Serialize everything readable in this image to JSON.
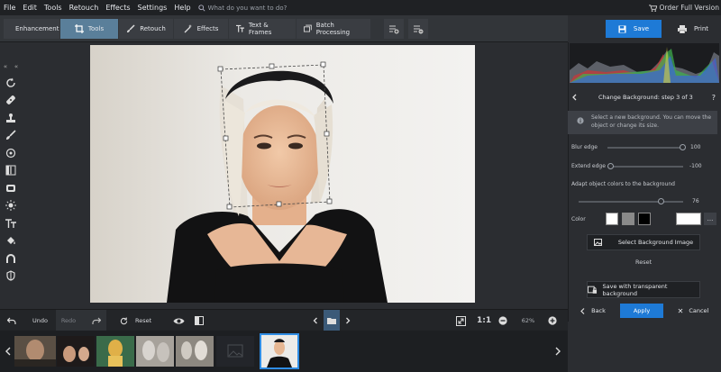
{
  "menu": {
    "items": [
      "File",
      "Edit",
      "Tools",
      "Retouch",
      "Effects",
      "Settings",
      "Help"
    ],
    "search_placeholder": "What do you want to do?",
    "order_label": "Order Full Version"
  },
  "toolbar": {
    "tabs": [
      {
        "label": "Enhancement",
        "icon": "sliders-icon",
        "active": false
      },
      {
        "label": "Tools",
        "icon": "crop-icon",
        "active": true
      },
      {
        "label": "Retouch",
        "icon": "brush-icon",
        "active": false
      },
      {
        "label": "Effects",
        "icon": "magic-wand-icon",
        "active": false
      },
      {
        "label": "Text & Frames",
        "icon": "text-icon",
        "active": false
      },
      {
        "label": "Batch Processing",
        "icon": "batch-icon",
        "active": false
      }
    ],
    "save_label": "Save",
    "print_label": "Print"
  },
  "left_tools": [
    "rotate-icon",
    "bandage-icon",
    "stamp-icon",
    "brush-icon",
    "target-icon",
    "gradient-icon",
    "frame-icon",
    "sun-icon",
    "text-tool-icon",
    "fill-icon",
    "clone-icon",
    "shield-icon"
  ],
  "panel": {
    "title": "Change Background: step 3 of 3",
    "help": "?",
    "info": "Select a new background. You can move the object or change its size.",
    "blur_edge": {
      "label": "Blur edge",
      "value": "100",
      "level": 1.0
    },
    "extend_edge": {
      "label": "Extend edge",
      "value": "-100",
      "level": 0.0
    },
    "adapt": {
      "label": "Adapt object colors to the background",
      "value": "76",
      "level": 0.76
    },
    "color_label": "Color",
    "colors": [
      "#ffffff",
      "#8a8a8a",
      "#000000"
    ],
    "selected_color": "#ffffff",
    "more": "...",
    "select_bg": "Select Background Image",
    "reset": "Reset",
    "save_transparent": "Save with transparent background",
    "back": "Back",
    "apply": "Apply",
    "cancel": "Cancel"
  },
  "bottom": {
    "undo": "Undo",
    "redo": "Redo",
    "reset": "Reset",
    "ratio": "1:1",
    "zoom": "62%"
  },
  "colors": {
    "accent": "#1e7ad6",
    "active_tab": "#5a7f9a",
    "bg": "#2b2d31"
  }
}
